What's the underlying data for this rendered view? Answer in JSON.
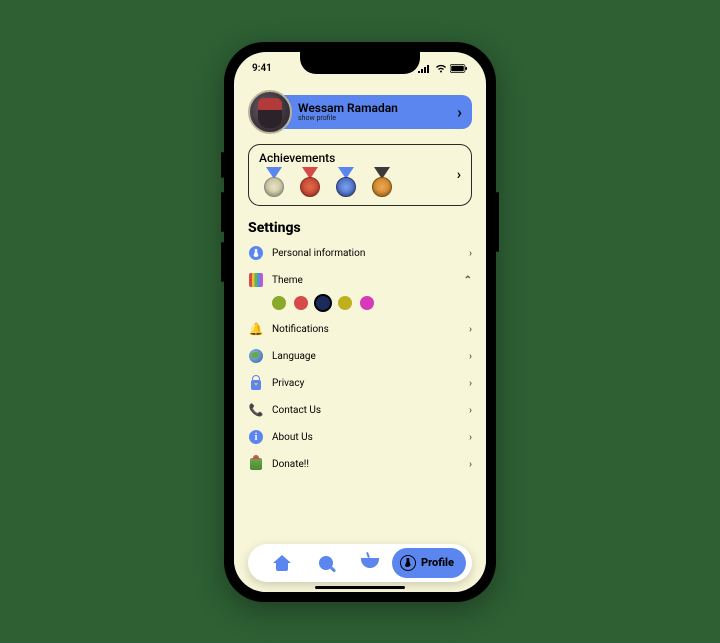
{
  "status": {
    "time": "9:41"
  },
  "profile": {
    "name": "Wessam Ramadan",
    "subtitle": "show profile"
  },
  "achievements": {
    "title": "Achievements"
  },
  "settings": {
    "title": "Settings",
    "items": {
      "personal": "Personal information",
      "theme": "Theme",
      "notifications": "Notifications",
      "language": "Language",
      "privacy": "Privacy",
      "contact": "Contact Us",
      "about": "About Us",
      "donate": "Donate!!"
    },
    "themeColors": {
      "c1": "#8aa82a",
      "c2": "#d64a4a",
      "c3": "#1a2a5a",
      "c4": "#c0b020",
      "c5": "#d63ab8"
    },
    "themeSelectedIndex": 2
  },
  "nav": {
    "profile_label": "Profile"
  }
}
